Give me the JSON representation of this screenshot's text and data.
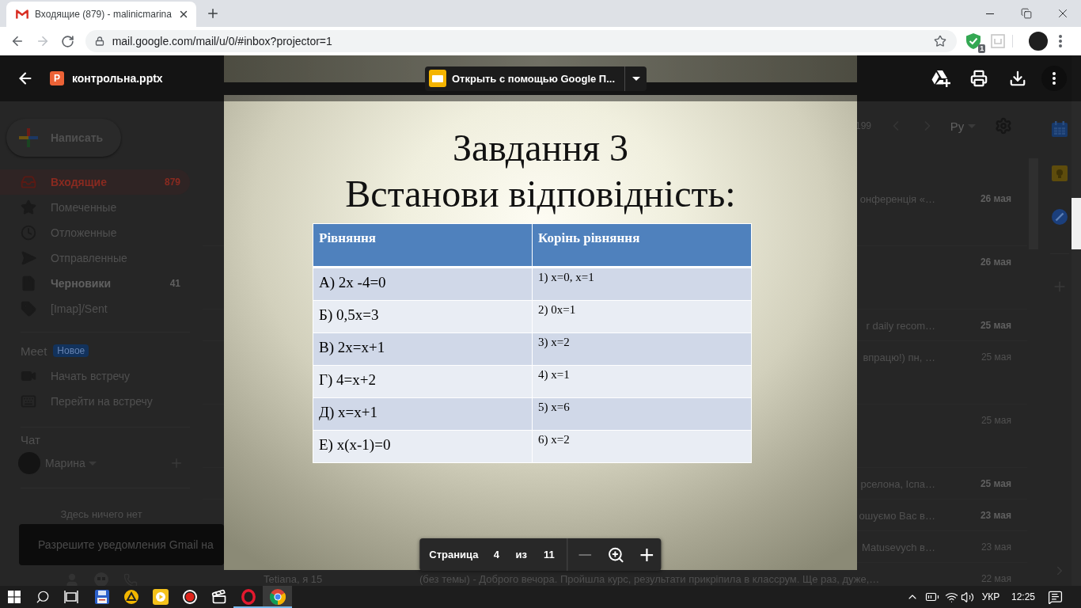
{
  "browser": {
    "tabs": [
      {
        "title": "Входящие (879) - malinicmarina",
        "selected": true
      }
    ],
    "forward": {
      "disabled": true
    },
    "url": "mail.google.com/mail/u/0/#inbox?projector=1",
    "extension_badge": "1"
  },
  "viewer": {
    "file_badge": "P",
    "file_name": "контрольна.pptx",
    "open_with": "Открыть с помощью Google П...",
    "slide": {
      "title_lines": [
        "Завдання 3",
        "Встанови відповідність:"
      ],
      "table": {
        "columns": [
          "Рівняння",
          "Корінь рівняння"
        ],
        "rows": [
          [
            "А) 2x -4=0",
            "1) x=0, x=1"
          ],
          [
            "Б) 0,5x=3",
            "2) 0x=1"
          ],
          [
            "В) 2x=x+1",
            "3) x=2"
          ],
          [
            "Г) 4=x+2",
            "4) x=1"
          ],
          [
            "Д) x=x+1",
            "5) x=6"
          ],
          [
            "Е) x(x-1)=0",
            "6) x=2"
          ]
        ]
      }
    },
    "page_control": {
      "label": "Страница",
      "page": "4",
      "separator": "из",
      "total": "11",
      "zoom_buttons": [
        {
          "kind": "minus",
          "disabled": true
        },
        {
          "kind": "magnifier",
          "disabled": false
        },
        {
          "kind": "plus",
          "disabled": false
        }
      ]
    }
  },
  "gmail": {
    "compose": "Написать",
    "folders": [
      {
        "kind": "inbox",
        "label": "Входящие",
        "count": "879",
        "selected": true,
        "unread": true
      },
      {
        "kind": "star",
        "label": "Помеченные",
        "selected": false,
        "unread": false
      },
      {
        "kind": "clock",
        "label": "Отложенные",
        "selected": false,
        "unread": false
      },
      {
        "kind": "send",
        "label": "Отправленные",
        "selected": false,
        "unread": false
      },
      {
        "kind": "draft",
        "label": "Черновики",
        "count": "41",
        "selected": false,
        "unread": true
      },
      {
        "kind": "label",
        "label": "[Imap]/Sent",
        "selected": false,
        "unread": false
      }
    ],
    "meet": {
      "title": "Meet",
      "badge": "Новое",
      "items": [
        {
          "kind": "video",
          "label": "Начать встречу"
        },
        {
          "kind": "keyboard",
          "label": "Перейти на встречу"
        }
      ]
    },
    "chat": {
      "title": "Чат",
      "user": "Марина",
      "empty_text": "Здесь ничего нет"
    },
    "notification": "Разрешите уведомления Gmail на",
    "list_toolbar": {
      "range": "199",
      "language": "Ру"
    },
    "messages": [
      {
        "kind": "attachment",
        "snippet": "онференція «…",
        "date": "26 мая",
        "unread": true
      },
      {
        "kind": "attachment",
        "date": "26 мая",
        "unread": true
      },
      {
        "kind": "plain",
        "snippet": "r daily recom…",
        "date": "25 мая",
        "unread": true
      },
      {
        "kind": "attachment",
        "snippet": "впрацю!) пн, …",
        "date": "25 мая",
        "unread": false
      },
      {
        "kind": "attachment",
        "date": "25 мая",
        "unread": false
      },
      {
        "kind": "plain",
        "snippet": "рселона, Іспа…",
        "date": "25 мая",
        "unread": true
      },
      {
        "kind": "plain",
        "snippet": "ошуємо Вас в…",
        "date": "23 мая",
        "unread": true
      },
      {
        "kind": "plain",
        "snippet": "Matusevych в…",
        "date": "23 мая",
        "unread": false
      },
      {
        "kind": "plain",
        "sender": "Tetiana, я 15",
        "snippet": "(без темы) - Доброго вечора. Пройшла курс, результати прикріпила в классрум. Ще раз, дуже,…",
        "date": "22 мая",
        "unread": false
      }
    ]
  },
  "taskbar": {
    "apps": [
      {
        "kind": "floppy",
        "running": false,
        "selected": false
      },
      {
        "kind": "triangle_disc",
        "running": false,
        "selected": false
      },
      {
        "kind": "play_tile",
        "running": false,
        "selected": false
      },
      {
        "kind": "record",
        "running": false,
        "selected": false
      },
      {
        "kind": "clapper",
        "running": false,
        "selected": false
      },
      {
        "kind": "ring",
        "running": true,
        "selected": false
      },
      {
        "kind": "tricolor",
        "running": true,
        "selected": true
      }
    ],
    "tray": {
      "language": "УКР",
      "time": "12:25"
    }
  }
}
